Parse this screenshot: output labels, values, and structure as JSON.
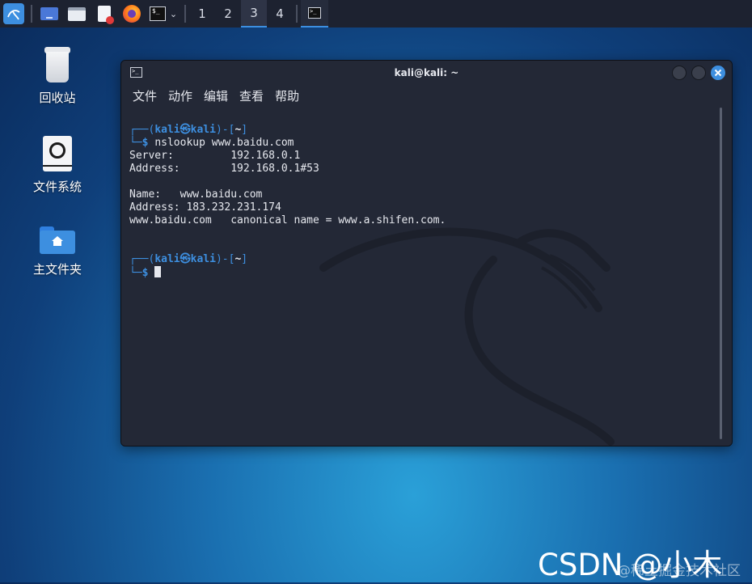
{
  "taskbar": {
    "workspaces": [
      "1",
      "2",
      "3",
      "4"
    ],
    "active_workspace": "3"
  },
  "desktop": {
    "icons": [
      {
        "label": "回收站",
        "icon": "trash-icon"
      },
      {
        "label": "文件系统",
        "icon": "drive-icon"
      },
      {
        "label": "主文件夹",
        "icon": "home-folder-icon"
      }
    ]
  },
  "window": {
    "title": "kali@kali: ~",
    "menu": [
      "文件",
      "动作",
      "编辑",
      "查看",
      "帮助"
    ]
  },
  "terminal": {
    "prompt_user": "kali",
    "prompt_at": "㉿",
    "prompt_host": "kali",
    "prompt_dir": "~",
    "command": "nslookup www.baidu.com",
    "output": [
      "Server:         192.168.0.1",
      "Address:        192.168.0.1#53",
      "",
      "Name:   www.baidu.com",
      "Address: 183.232.231.174",
      "www.baidu.com   canonical name = www.a.shifen.com.",
      "",
      ""
    ]
  },
  "watermark": {
    "main": "CSDN @小木",
    "sub": "@稀土掘金技术社区"
  },
  "colors": {
    "accent": "#3d8fe0",
    "terminal_bg": "#232836",
    "taskbar_bg": "#1d2230"
  }
}
